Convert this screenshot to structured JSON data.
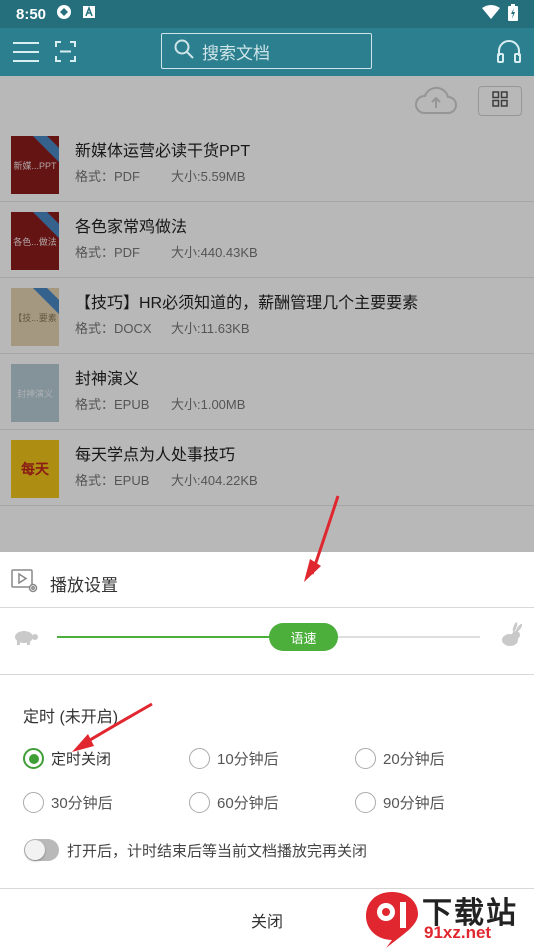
{
  "status_bar": {
    "time": "8:50"
  },
  "header": {
    "search_placeholder": "搜索文档"
  },
  "documents": [
    {
      "title": "新媒体运营必读干货PPT",
      "format": "格式：PDF",
      "size": "大小:5.59MB",
      "cover_text": "新媒...PPT",
      "cover_color": "#8c1c1c"
    },
    {
      "title": "各色家常鸡做法",
      "format": "格式：PDF",
      "size": "大小:440.43KB",
      "cover_text": "各色...做法",
      "cover_color": "#8c1c1c"
    },
    {
      "title": "【技巧】HR必须知道的，薪酬管理几个主要要素",
      "format": "格式：DOCX",
      "size": "大小:11.63KB",
      "cover_text": "【技...要素",
      "cover_color": "#e3d4b2"
    },
    {
      "title": "封神演义",
      "format": "格式：EPUB",
      "size": "大小:1.00MB",
      "cover_text": "封神演义",
      "cover_color": "#b7cbd6"
    },
    {
      "title": "每天学点为人处事技巧",
      "format": "格式：EPUB",
      "size": "大小:404.22KB",
      "cover_text": "每天",
      "cover_color": "#f0c419"
    }
  ],
  "sheet": {
    "title": "播放设置",
    "speed_label": "语速",
    "speed_fraction": 0.55,
    "timer_label": "定时 (未开启)",
    "options": [
      "定时关闭",
      "10分钟后",
      "20分钟后",
      "30分钟后",
      "60分钟后",
      "90分钟后"
    ],
    "selected_option": 0,
    "toggle_label": "打开后，计时结束后等当前文档播放完再关闭",
    "toggle_on": false,
    "close_label": "关闭"
  },
  "watermark": {
    "main": "下载站",
    "sub": "91xz.net"
  },
  "colors": {
    "app_bar": "#2b7f8e",
    "accent_green": "#4caf3c",
    "annotation_red": "#e0262e"
  }
}
